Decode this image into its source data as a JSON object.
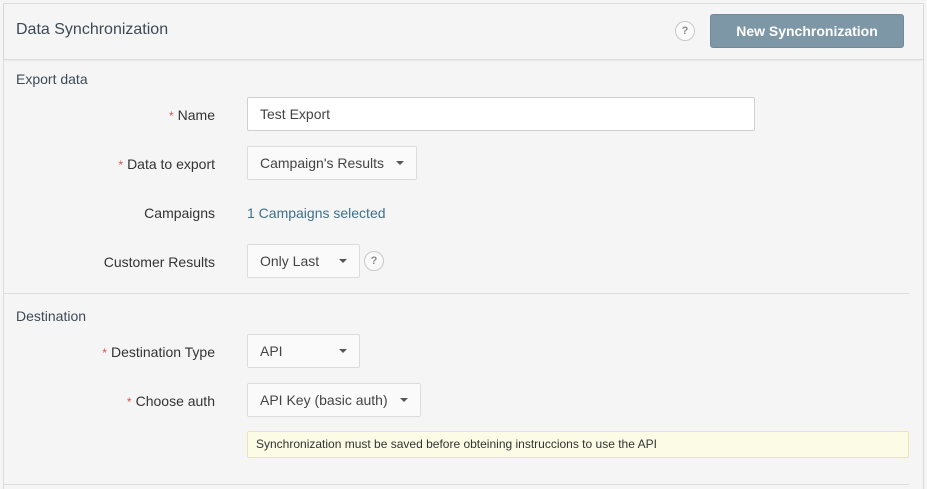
{
  "header": {
    "title": "Data Synchronization",
    "help_icon": "?",
    "new_button_label": "New Synchronization"
  },
  "export_section": {
    "title": "Export data",
    "name": {
      "label": "Name",
      "required_mark": "*",
      "value": "Test Export"
    },
    "data_to_export": {
      "label": "Data to export",
      "required_mark": "*",
      "value": "Campaign's Results"
    },
    "campaigns": {
      "label": "Campaigns",
      "value": "1 Campaigns selected"
    },
    "customer_results": {
      "label": "Customer Results",
      "value": "Only Last",
      "help_icon": "?"
    }
  },
  "destination_section": {
    "title": "Destination",
    "destination_type": {
      "label": "Destination Type",
      "required_mark": "*",
      "value": "API"
    },
    "choose_auth": {
      "label": "Choose auth",
      "required_mark": "*",
      "value": "API Key (basic auth)"
    },
    "notice": "Synchronization must be saved before obteining instruccions to use the API"
  },
  "colors": {
    "primary_button": "#7e97a6",
    "link": "#3f6f8c",
    "required": "#d9534f",
    "notice_bg": "#fcfbe5"
  }
}
